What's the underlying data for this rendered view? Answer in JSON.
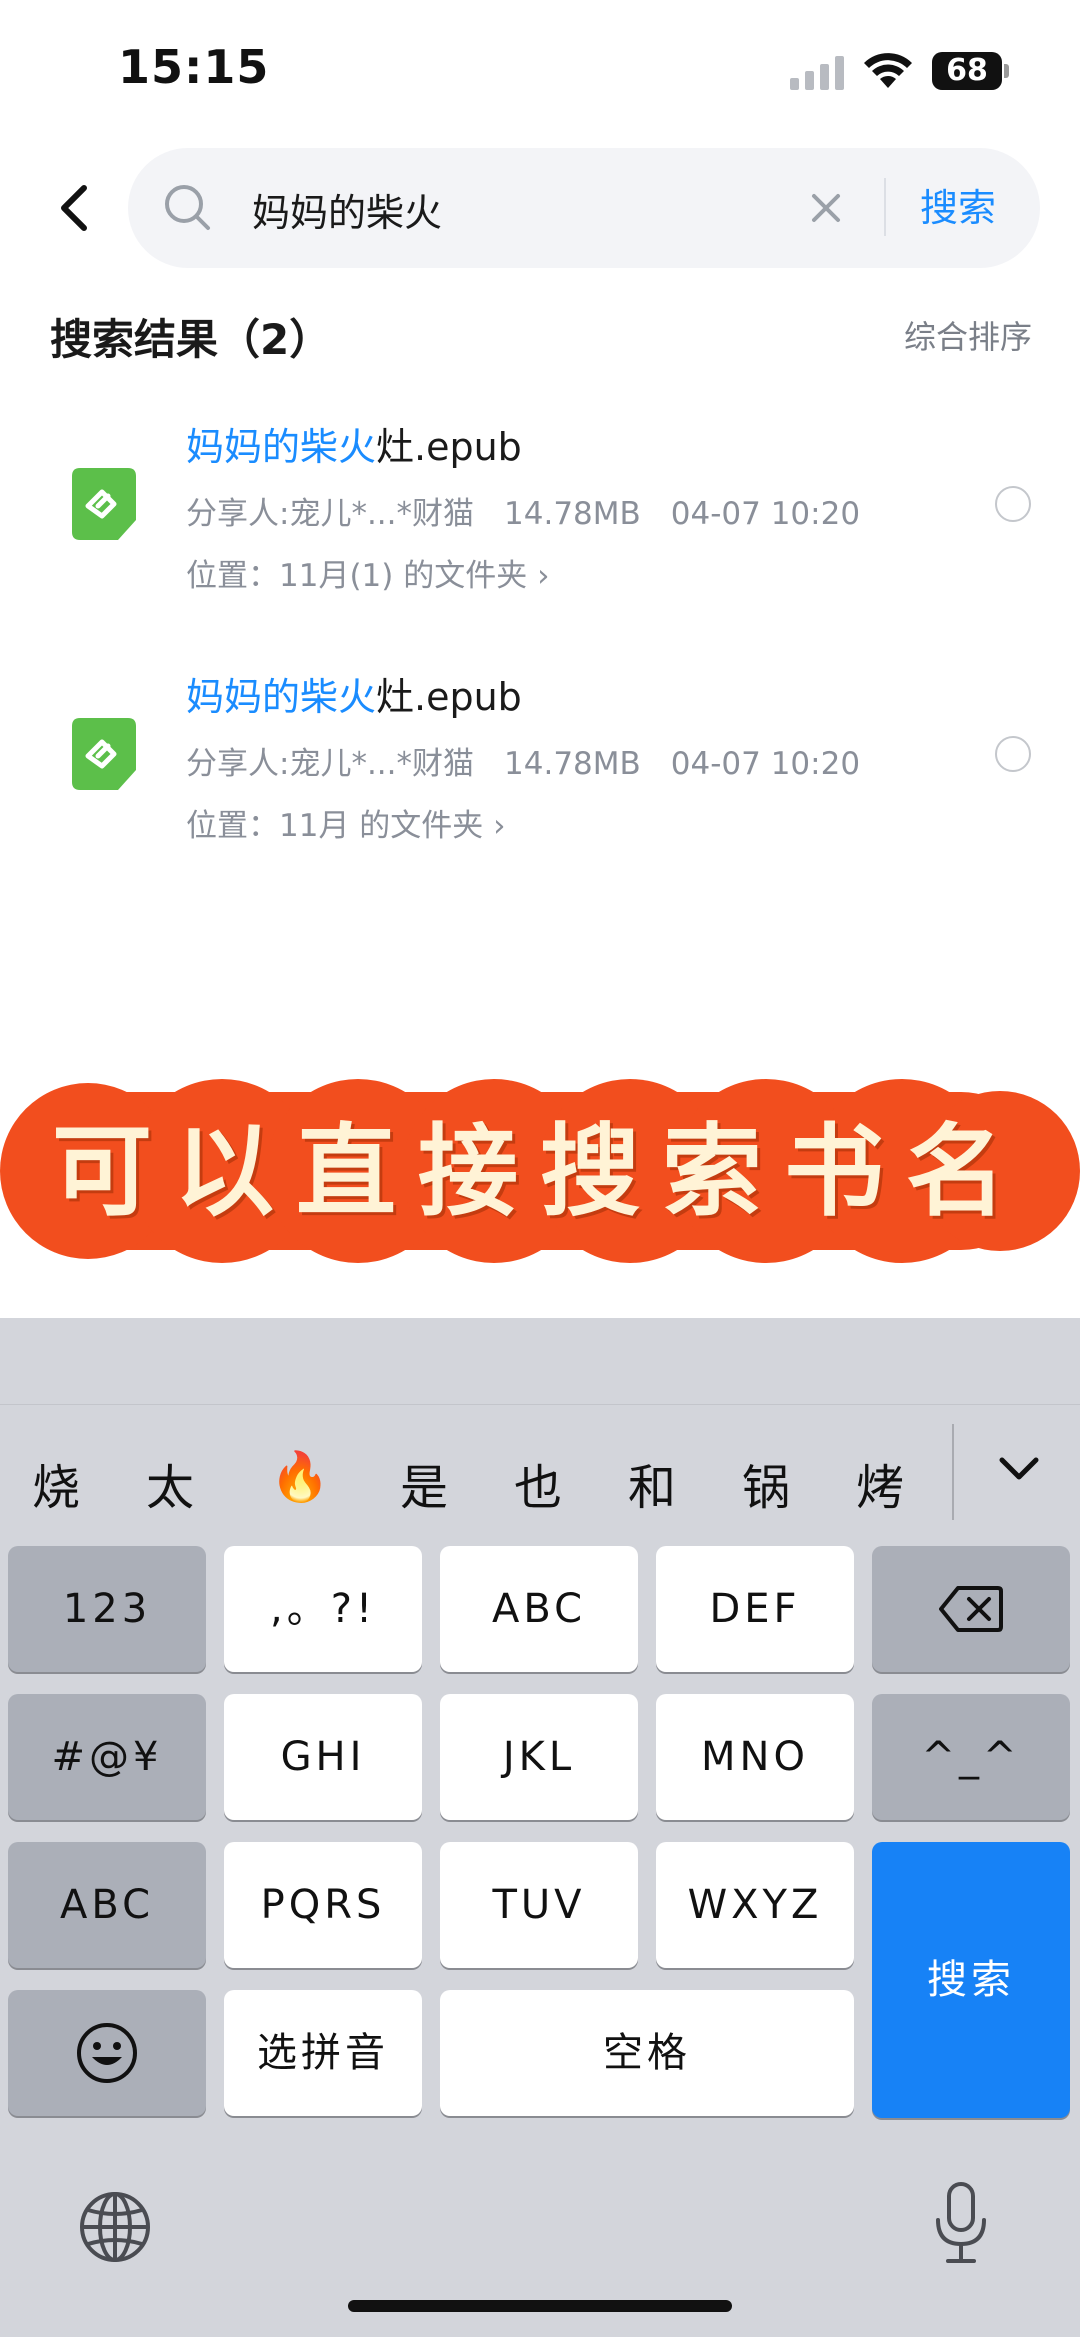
{
  "status_bar": {
    "time": "15:15",
    "battery": "68"
  },
  "search": {
    "query": "妈妈的柴火",
    "button_label": "搜索"
  },
  "results": {
    "title": "搜索结果（2）",
    "sort_label": "综合排序",
    "items": [
      {
        "title_highlight": "妈妈的柴火",
        "title_rest": "灶.epub",
        "sharer": "分享人:宠儿*...*财猫",
        "size": "14.78MB",
        "date": "04-07 10:20",
        "location": "位置：11月(1) 的文件夹"
      },
      {
        "title_highlight": "妈妈的柴火",
        "title_rest": "灶.epub",
        "sharer": "分享人:宠儿*...*财猫",
        "size": "14.78MB",
        "date": "04-07 10:20",
        "location": "位置：11月 的文件夹"
      }
    ]
  },
  "banner": {
    "text": "可以直接搜索书名",
    "color": "#f24e1e"
  },
  "keyboard": {
    "candidates": [
      "烧",
      "太",
      "🔥",
      "是",
      "也",
      "和",
      "锅",
      "烤"
    ],
    "keys": {
      "num": "123",
      "punct": ",。?!",
      "abc": "ABC",
      "def": "DEF",
      "symbols": "#@¥",
      "ghi": "GHI",
      "jkl": "JKL",
      "mno": "MNO",
      "emoticon": "^_^",
      "abc_mode": "ABC",
      "pqrs": "PQRS",
      "tuv": "TUV",
      "wxyz": "WXYZ",
      "search": "搜索",
      "pinyin": "选拼音",
      "space": "空格"
    }
  },
  "colors": {
    "accent": "#1a8cff",
    "epub_icon": "#5cbf4a",
    "keyboard_bg": "#d3d5db",
    "search_key": "#1782f6"
  }
}
